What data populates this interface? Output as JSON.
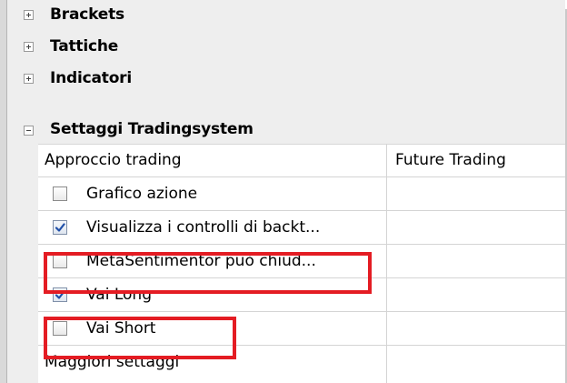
{
  "groups": [
    {
      "label": "Brackets",
      "state": "collapsed"
    },
    {
      "label": "Tattiche",
      "state": "collapsed"
    },
    {
      "label": "Indicatori",
      "state": "collapsed"
    },
    {
      "label": "Settaggi Tradingsystem",
      "state": "expanded"
    }
  ],
  "settings": {
    "rows": [
      {
        "label": "Approccio trading",
        "value": "Future Trading"
      },
      {
        "label": "Grafico azione",
        "checked": false,
        "value": ""
      },
      {
        "label": "Visualizza i controlli di backt...",
        "checked": true,
        "value": ""
      },
      {
        "label": "MetaSentimentor può chiud...",
        "checked": false,
        "value": ""
      },
      {
        "label": "Vai Long",
        "checked": true,
        "value": ""
      },
      {
        "label": "Vai Short",
        "checked": false,
        "value": ""
      },
      {
        "label": "Maggiori settaggi",
        "value": ""
      }
    ]
  },
  "colors": {
    "highlight": "#e41c23",
    "group_background": "#eeeeee",
    "grid_line": "#d4d4d4"
  }
}
